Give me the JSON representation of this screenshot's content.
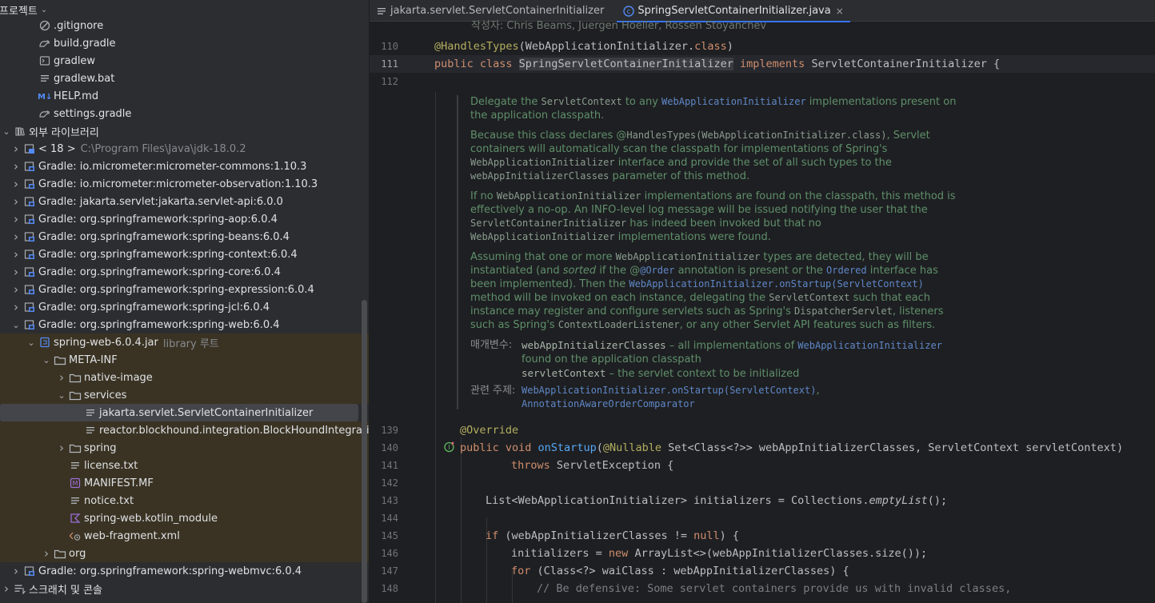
{
  "project": {
    "header": "프로젝트",
    "tree": [
      {
        "label": ".gitignore",
        "icon": "gitignore-icon",
        "indent": 2,
        "arrow": "",
        "bg": ""
      },
      {
        "label": "build.gradle",
        "icon": "gradle-icon",
        "indent": 2,
        "arrow": "",
        "bg": ""
      },
      {
        "label": "gradlew",
        "icon": "terminal-file-icon",
        "indent": 2,
        "arrow": "",
        "bg": ""
      },
      {
        "label": "gradlew.bat",
        "icon": "text-file-icon",
        "indent": 2,
        "arrow": "",
        "bg": ""
      },
      {
        "label": "HELP.md",
        "icon": "markdown-icon",
        "indent": 2,
        "arrow": "",
        "bg": ""
      },
      {
        "label": "settings.gradle",
        "icon": "gradle-icon",
        "indent": 2,
        "arrow": "",
        "bg": ""
      },
      {
        "label": "외부 라이브러리",
        "icon": "library-icon",
        "indent": 0,
        "arrow": "down",
        "bg": ""
      },
      {
        "label": "< 18 >",
        "extra": "C:\\Program Files\\Java\\jdk-18.0.2",
        "icon": "jdk-icon",
        "indent": 1,
        "arrow": "right",
        "bg": ""
      },
      {
        "label": "Gradle: io.micrometer:micrometer-commons:1.10.3",
        "icon": "jar-library-icon",
        "indent": 1,
        "arrow": "right",
        "bg": ""
      },
      {
        "label": "Gradle: io.micrometer:micrometer-observation:1.10.3",
        "icon": "jar-library-icon",
        "indent": 1,
        "arrow": "right",
        "bg": ""
      },
      {
        "label": "Gradle: jakarta.servlet:jakarta.servlet-api:6.0.0",
        "icon": "jar-library-icon",
        "indent": 1,
        "arrow": "right",
        "bg": ""
      },
      {
        "label": "Gradle: org.springframework:spring-aop:6.0.4",
        "icon": "jar-library-icon",
        "indent": 1,
        "arrow": "right",
        "bg": ""
      },
      {
        "label": "Gradle: org.springframework:spring-beans:6.0.4",
        "icon": "jar-library-icon",
        "indent": 1,
        "arrow": "right",
        "bg": ""
      },
      {
        "label": "Gradle: org.springframework:spring-context:6.0.4",
        "icon": "jar-library-icon",
        "indent": 1,
        "arrow": "right",
        "bg": ""
      },
      {
        "label": "Gradle: org.springframework:spring-core:6.0.4",
        "icon": "jar-library-icon",
        "indent": 1,
        "arrow": "right",
        "bg": ""
      },
      {
        "label": "Gradle: org.springframework:spring-expression:6.0.4",
        "icon": "jar-library-icon",
        "indent": 1,
        "arrow": "right",
        "bg": ""
      },
      {
        "label": "Gradle: org.springframework:spring-jcl:6.0.4",
        "icon": "jar-library-icon",
        "indent": 1,
        "arrow": "right",
        "bg": ""
      },
      {
        "label": "Gradle: org.springframework:spring-web:6.0.4",
        "icon": "jar-library-icon",
        "indent": 1,
        "arrow": "down",
        "bg": ""
      },
      {
        "label": "spring-web-6.0.4.jar",
        "extra": "library 루트",
        "icon": "jar-icon",
        "indent": 2,
        "arrow": "down",
        "bg": "lib"
      },
      {
        "label": "META-INF",
        "icon": "folder-icon",
        "indent": 3,
        "arrow": "down",
        "bg": "lib"
      },
      {
        "label": "native-image",
        "icon": "folder-icon",
        "indent": 4,
        "arrow": "right",
        "bg": "lib"
      },
      {
        "label": "services",
        "icon": "folder-icon",
        "indent": 4,
        "arrow": "down",
        "bg": "lib"
      },
      {
        "label": "jakarta.servlet.ServletContainerInitializer",
        "icon": "text-file-icon",
        "indent": 5,
        "arrow": "",
        "bg": "selected"
      },
      {
        "label": "reactor.blockhound.integration.BlockHoundIntegration",
        "icon": "text-file-icon",
        "indent": 5,
        "arrow": "",
        "bg": "lib"
      },
      {
        "label": "spring",
        "icon": "folder-icon",
        "indent": 4,
        "arrow": "right",
        "bg": "lib"
      },
      {
        "label": "license.txt",
        "icon": "text-file-icon",
        "indent": 4,
        "arrow": "",
        "bg": "lib"
      },
      {
        "label": "MANIFEST.MF",
        "icon": "manifest-icon",
        "indent": 4,
        "arrow": "",
        "bg": "lib"
      },
      {
        "label": "notice.txt",
        "icon": "text-file-icon",
        "indent": 4,
        "arrow": "",
        "bg": "lib"
      },
      {
        "label": "spring-web.kotlin_module",
        "icon": "kotlin-icon",
        "indent": 4,
        "arrow": "",
        "bg": "lib"
      },
      {
        "label": "web-fragment.xml",
        "icon": "xml-file-icon",
        "indent": 4,
        "arrow": "",
        "bg": "lib"
      },
      {
        "label": "org",
        "icon": "folder-icon",
        "indent": 3,
        "arrow": "right",
        "bg": "lib"
      },
      {
        "label": "Gradle: org.springframework:spring-webmvc:6.0.4",
        "icon": "jar-library-icon",
        "indent": 1,
        "arrow": "right",
        "bg": ""
      },
      {
        "label": "스크래치 및 콘솔",
        "icon": "scratches-icon",
        "indent": 0,
        "arrow": "right",
        "bg": ""
      }
    ]
  },
  "editor": {
    "tabs": [
      {
        "label": "jakarta.servlet.ServletContainerInitializer",
        "icon": "text-file-icon",
        "active": false
      },
      {
        "label": "SpringServletContainerInitializer.java",
        "icon": "java-class-icon",
        "active": true,
        "close": "×"
      }
    ],
    "top_partial_text": "작성자:    Chris Beams, Juergen Hoeller, Rossen Stoyanchev",
    "line_numbers": {
      "l110": "110",
      "l111": "111",
      "l112": "112",
      "l139": "139",
      "l140": "140",
      "l141": "141",
      "l142": "142",
      "l143": "143",
      "l144": "144",
      "l145": "145",
      "l146": "146",
      "l147": "147",
      "l148": "148"
    },
    "doc": {
      "p1_a": "Delegate the ",
      "p1_b": "ServletContext",
      "p1_c": " to any ",
      "p1_d": "WebApplicationInitializer",
      "p1_e": " implementations present on the application classpath.",
      "p2_a": "Because this class declares @",
      "p2_b": "HandlesTypes(WebApplicationInitializer.class)",
      "p2_c": ", Servlet containers will automatically scan the classpath for implementations of Spring's ",
      "p2_d": "WebApplicationInitializer",
      "p2_e": " interface and provide the set of all such types to the ",
      "p2_f": "webAppInitializerClasses",
      "p2_g": " parameter of this method.",
      "p3_a": "If no ",
      "p3_b": "WebApplicationInitializer",
      "p3_c": " implementations are found on the classpath, this method is effectively a no-op. An INFO-level log message will be issued notifying the user that the ",
      "p3_d": "ServletContainerInitializer",
      "p3_e": " has indeed been invoked but that no ",
      "p3_f": "WebApplicationInitializer",
      "p3_g": " implementations were found.",
      "p4_a": "Assuming that one or more ",
      "p4_b": "WebApplicationInitializer",
      "p4_c": " types are detected, they will be instantiated (and ",
      "p4_d": "sorted",
      "p4_e": " if the @",
      "p4_f": "@Order",
      "p4_g": " annotation is present or the ",
      "p4_h": "Ordered",
      "p4_i": " interface has been implemented). Then the ",
      "p4_j": "WebApplicationInitializer.onStartup(ServletContext)",
      "p4_k": " method will be invoked on each instance, delegating the ",
      "p4_l": "ServletContext",
      "p4_m": " such that each instance may register and configure servlets such as Spring's ",
      "p4_n": "DispatcherServlet",
      "p4_o": ", listeners such as Spring's ",
      "p4_p": "ContextLoaderListener",
      "p4_q": ", or any other Servlet API features such as filters.",
      "params_key": "매개변수:",
      "param1_name": "webAppInitializerClasses",
      "param1_desc": " – all implementations of ",
      "param1_link": "WebApplicationInitializer",
      "param1_desc2": " found on the application classpath",
      "param2_name": "servletContext",
      "param2_desc": " – the servlet context to be initialized",
      "see_key": "관련 주제:",
      "see1": "WebApplicationInitializer.onStartup(ServletContext)",
      "see1_sep": ",",
      "see2": "AnnotationAwareOrderComparator"
    },
    "code": {
      "l110_ann": "@HandlesTypes",
      "l110_rest": "(WebApplicationInitializer.",
      "l110_kw": "class",
      "l110_end": ")",
      "l111_kw1": "public class ",
      "l111_cls": "SpringServletContainerInitializer",
      "l111_kw2": " implements ",
      "l111_rest": "ServletContainerInitializer {",
      "l139_ann": "@Override",
      "l140_kw": "public void ",
      "l140_fn": "onStartup",
      "l140_p1": "(",
      "l140_ann": "@Nullable",
      "l140_rest": " Set<Class<?>> webAppInitializerClasses, ServletContext servletContext)",
      "l141_kw": "throws ",
      "l141_rest": "ServletException {",
      "l143_a": "List<WebApplicationInitializer> initializers = Collections.",
      "l143_it": "emptyList",
      "l143_b": "();",
      "l145_kw": "if ",
      "l145_a": "(webAppInitializerClasses != ",
      "l145_kw2": "null",
      "l145_b": ") {",
      "l146_a": "initializers = ",
      "l146_kw": "new ",
      "l146_b": "ArrayList<>(webAppInitializerClasses.size());",
      "l147_kw": "for ",
      "l147_a": "(Class<?> waiClass : webAppInitializerClasses) {",
      "l148_cm": "// Be defensive: Some servlet containers provide us with invalid classes,"
    }
  }
}
